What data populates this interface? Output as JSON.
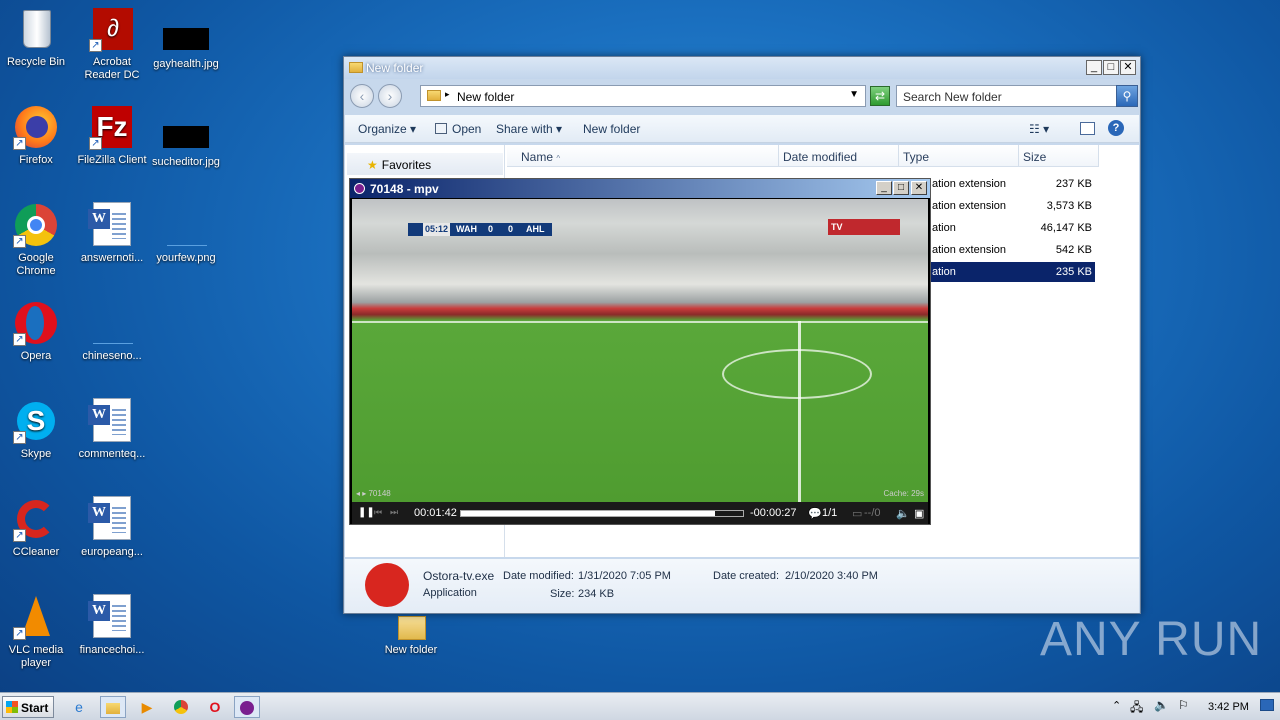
{
  "desktop": {
    "icons": [
      {
        "label": "Recycle Bin"
      },
      {
        "label": "Acrobat Reader DC"
      },
      {
        "label": "gayhealth.jpg"
      },
      {
        "label": "Firefox"
      },
      {
        "label": "FileZilla Client"
      },
      {
        "label": "sucheditor.jpg"
      },
      {
        "label": "Google Chrome"
      },
      {
        "label": "answernoti..."
      },
      {
        "label": "yourfew.png"
      },
      {
        "label": "Opera"
      },
      {
        "label": "chineseno..."
      },
      {
        "label": "Skype"
      },
      {
        "label": "commenteq..."
      },
      {
        "label": "CCleaner"
      },
      {
        "label": "europeang..."
      },
      {
        "label": "VLC media player"
      },
      {
        "label": "financechoi..."
      },
      {
        "label": "New folder"
      }
    ]
  },
  "explorer": {
    "title": "New folder",
    "address": "New folder",
    "search_placeholder": "Search New folder",
    "toolbar": {
      "organize": "Organize",
      "open": "Open",
      "share_with": "Share with",
      "new_folder": "New folder"
    },
    "nav": {
      "favorites": "Favorites"
    },
    "columns": {
      "name": "Name",
      "date_modified": "Date modified",
      "type": "Type",
      "size": "Size"
    },
    "rows": [
      {
        "type": "ation extension",
        "size": "237 KB"
      },
      {
        "type": "ation extension",
        "size": "3,573 KB"
      },
      {
        "type": "ation",
        "size": "46,147 KB"
      },
      {
        "type": "ation extension",
        "size": "542 KB"
      },
      {
        "type": "ation",
        "size": "235 KB"
      }
    ],
    "details": {
      "filename": "Ostora-tv.exe",
      "date_modified_label": "Date modified:",
      "date_modified": "1/31/2020 7:05 PM",
      "date_created_label": "Date created:",
      "date_created": "2/10/2020 3:40 PM",
      "kind": "Application",
      "size_label": "Size:",
      "size": "234 KB"
    }
  },
  "mpv": {
    "title": "70148 - mpv",
    "scoreboard": {
      "clock": "05:12",
      "home": "WAH",
      "home_score": "0",
      "away_score": "0",
      "away": "AHL"
    },
    "channel": "TV",
    "osd_name": "70148",
    "cache": "Cache:  29s",
    "elapsed": "00:01:42",
    "remaining": "-00:00:27",
    "subs": "1/1",
    "audio": "--/0",
    "progress": 0.9
  },
  "taskbar": {
    "start": "Start",
    "clock": "3:42 PM"
  },
  "watermark": "ANY RUN",
  "colors": {
    "selection": "#0a246a",
    "mpv_accent": "#7a1f8f"
  }
}
